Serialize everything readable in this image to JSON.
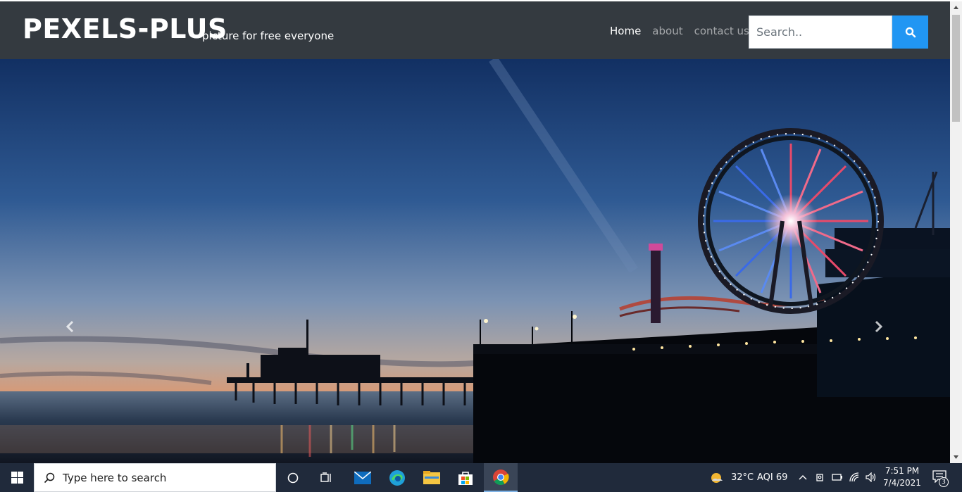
{
  "navbar": {
    "brand": "PEXELS-PLUS",
    "tagline": "picture for free everyone",
    "links": [
      {
        "label": "Home",
        "active": true
      },
      {
        "label": "about",
        "active": false
      },
      {
        "label": "contact us",
        "active": false
      }
    ],
    "search_placeholder": "Search..",
    "search_button_icon": "search-icon"
  },
  "hero": {
    "image": "pier-sunset-ferris-wheel",
    "prev_icon": "chevron-left-icon",
    "next_icon": "chevron-right-icon"
  },
  "taskbar": {
    "search_placeholder": "Type here to search",
    "weather_temp": "32°C",
    "aqi": "AQI 69",
    "time": "7:51 PM",
    "date": "7/4/2021",
    "notification_count": "3",
    "pinned_apps": [
      "cortana-icon",
      "task-view-icon",
      "mail-icon",
      "edge-icon",
      "file-explorer-icon",
      "store-icon",
      "chrome-icon"
    ]
  },
  "colors": {
    "navbar_bg": "#343a40",
    "search_button": "#2196f3",
    "taskbar_bg": "#202a3b"
  }
}
